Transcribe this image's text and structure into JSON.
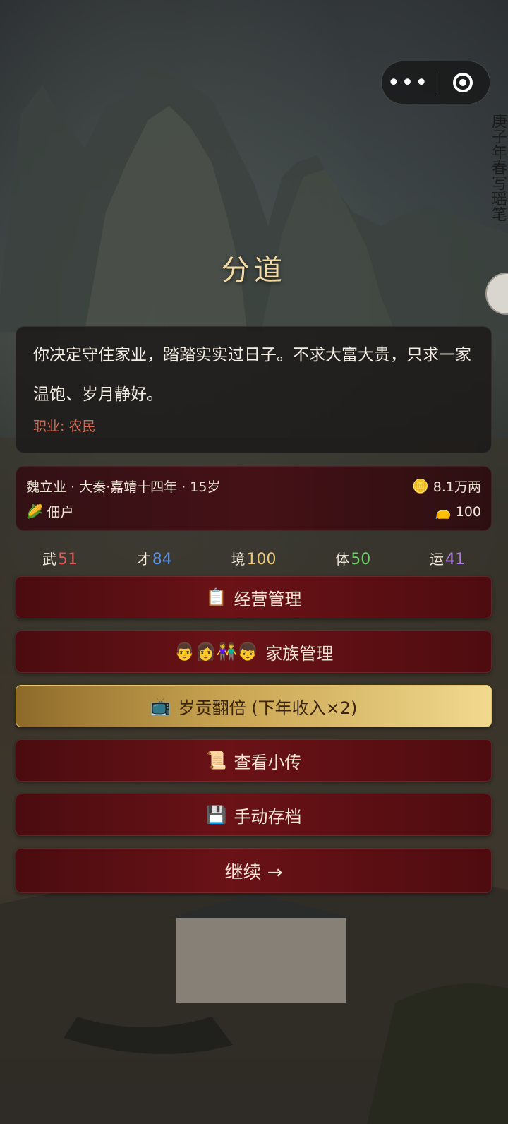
{
  "title": "分道",
  "top_capsule": {
    "more_label": "•••",
    "close_icon": "target-icon"
  },
  "side_text": "庚子年春写瑶笔",
  "story": {
    "text": "你决定守住家业，踏踏实实过日子。不求大富大贵，只求一家温饱、岁月静好。",
    "job": "职业: 农民"
  },
  "info": {
    "name_line": "魏立业 · 大秦·嘉靖十四年 · 15岁",
    "money": "8.1万两",
    "class": "佃户",
    "food": "100"
  },
  "stats": [
    {
      "label": "武",
      "value": "51",
      "color": "#e0585a"
    },
    {
      "label": "才",
      "value": "84",
      "color": "#5a8fe0"
    },
    {
      "label": "境",
      "value": "100",
      "color": "#e8c77a"
    },
    {
      "label": "体",
      "value": "50",
      "color": "#6fce6a"
    },
    {
      "label": "运",
      "value": "41",
      "color": "#b07ae0"
    }
  ],
  "buttons": {
    "business": {
      "label": "经营管理",
      "icon": "📋"
    },
    "family": {
      "label": "家族管理",
      "icon": "👨👩👫👦"
    },
    "tribute": {
      "label": "岁贡翻倍 (下年收入×2)",
      "icon": "📺"
    },
    "biography": {
      "label": "查看小传",
      "icon": "📜"
    },
    "save": {
      "label": "手动存档",
      "icon": "💾"
    },
    "continue": {
      "label": "继续 →"
    }
  }
}
